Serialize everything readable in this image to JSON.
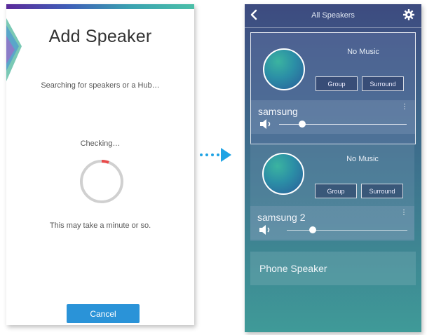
{
  "left": {
    "title": "Add Speaker",
    "subtitle": "Searching for speakers or a Hub…",
    "checking": "Checking…",
    "note": "This may take a minute or so.",
    "cancel_label": "Cancel"
  },
  "right": {
    "header_title": "All Speakers",
    "cards": [
      {
        "status": "No Music",
        "group_label": "Group",
        "surround_label": "Surround",
        "speaker_name": "samsung",
        "volume_fraction": 0.12
      },
      {
        "status": "No Music",
        "group_label": "Group",
        "surround_label": "Surround",
        "speaker_name": "samsung 2",
        "volume_fraction": 0.2
      }
    ],
    "phone_speaker_label": "Phone Speaker"
  },
  "colors": {
    "accent_blue": "#2a93d8",
    "spinner_red": "#e84a4a",
    "arrow_blue": "#1ea3e4"
  },
  "icons": [
    "back-chevron-icon",
    "gear-icon",
    "volume-icon",
    "more-dots-icon",
    "spinner-icon",
    "arrow-right-icon"
  ]
}
